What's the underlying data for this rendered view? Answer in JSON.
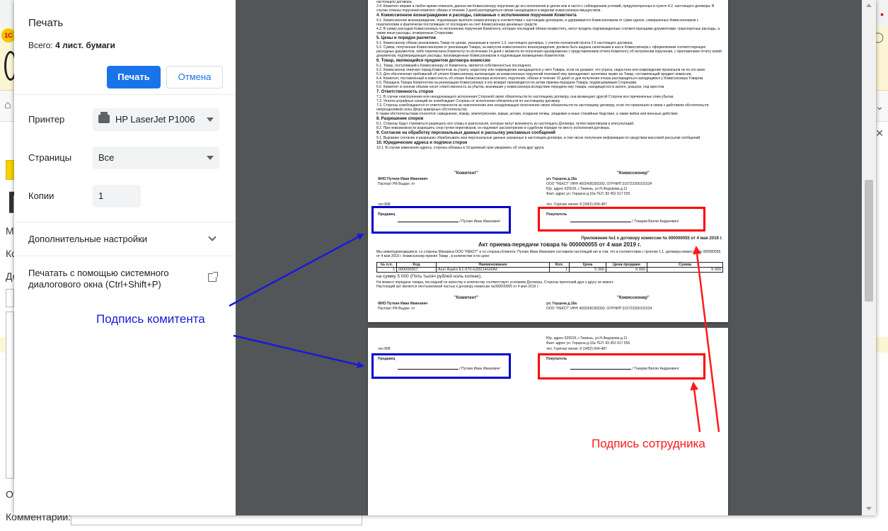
{
  "background": {
    "logo_text": "1С",
    "big_letter": "П",
    "labels": [
      "Ма",
      "Ко",
      "До"
    ],
    "bottom_label": "От",
    "comment_label": "Комментарий:"
  },
  "dialog": {
    "title": "Печать",
    "total_label": "Всего:",
    "total_value": "4 лист. бумаги",
    "print_button": "Печать",
    "cancel_button": "Отмена",
    "printer_label": "Принтер",
    "printer_value": "HP LaserJet P1006",
    "pages_label": "Страницы",
    "pages_value": "Все",
    "copies_label": "Копии",
    "copies_value": "1",
    "more_settings": "Дополнительные настройки",
    "system_dialog": "Печатать с помощью системного диалогового окна (Ctrl+Shift+P)"
  },
  "document": {
    "p1_top_lines": [
      "настоящего договора.",
      "3.4. Комитент вправе в любое время отменить данное им Комиссионеру поручение до его исполнения в целом или в части с соблюдением условий, предусмотренных в пункте 4.2. настоящего договора. В случае отмены поручения комитент обязан в течение 3 дней распорядиться своим находящимся в ведении комиссионера имуществом."
    ],
    "s4_title": "4. Комиссионное вознаграждение и расходы, связанные с исполнением поручения Комитента",
    "s4_lines": [
      "4.1. Комиссионное вознаграждение, подлежащее выплате комиссионеру в соответствии с настоящим договором, и удерживается Комиссионером от сумм сделок, совершенных Комиссионером с покупателями и фактически поступивших от последних на счет Комиссионера денежных средств.",
      "4.2. В сумму расходов Комиссионера по исполнению поручения Комитента, которые последний обязан возместить, могут входить подтвержденные соответствующими документами: транспортные расходы, а также иные расходы, оговоренные Сторонами."
    ],
    "s5_title": "5. Цены и порядок расчетов",
    "s5_lines": [
      "5.1. Комиссионер обязан реализовать Товар по ценам, указанным в пункте 1.2. настоящего договора, с учетом положений пункта 2.6 настоящего договора.",
      "5.2. Сумма, полученная Комиссионером от реализации Товара, за минусом комиссионного вознаграждения, должна быть выдана наличными в кассе Комиссионера с оформлением соответствующих расходных документов, либо перечислена Комитенту по истечении 14 дней с момента ее получения одновременно с представлением отчета Комитенту об исполнении поручения, с приложением отчету копий документов, подтверждающих расходы, произведенные Комиссионером и подлежащие возмещению Комитентом."
    ],
    "s6_title": "6. Товар, являющийся предметом договора комиссии",
    "s6_lines": [
      "6.1. Товар, поступивший к Комиссионеру от Комитента, является собственностью последнего.",
      "6.2. Комиссионер отвечает перед Комитентом за утрату, недостачу или повреждение находящегося у него Товара, если не докажет, что утрата, недостача или повреждение произошли не по его вине.",
      "6.3. Для обеспечения требований об уплате Комиссионеру вытекающих из комиссионных поручений платежей ему принадлежит залоговое право на Товар, составляющий предмет комиссии.",
      "6.4. Комитент, поставленный в известность об отказе Комиссионера исполнить поручение, обязан в течение 10 дней со дня получения отказа распорядиться находящимся у Комиссионера Товаром.",
      "6.5. Передача Товара Комитентом на реализацию Комиссионеру и его возврат производится по актам приема-передачи Товара, подписываемым Сторонами.",
      "6.6. Комитент в полном объеме несет ответственность за убытки, возникшие у комиссионера вследствие передачи ему товара, находящегося в залоге, розыске, под арестом."
    ],
    "s7_title": "7. Ответственность сторон",
    "s7_lines": [
      "7.1. В случае неисполнения или ненадлежащего исполнения Стороной своих обязательств по настоящему договору, она возмещает другой Стороне все причиненные этим убытки.",
      "7.2. Уплата штрафных санкций не освобождает Стороны от исполнения обязательств по настоящему договору.",
      "7.3. Стороны освобождаются от ответственности за неисполнение или ненадлежащее исполнение своих обязательств по настоящему договору, если это произошло в связи с действием обстоятельств непреодолимой силы (форс-мажорных обстоятельств).",
      "К таким обстоятельствам относятся: наводнение, пожар, землетрясение, взрыв, шторм, оседание почвы, эпидемия и иные стихийные бедствия, а также война или военные действия."
    ],
    "s8_title": "8. Разрешение споров",
    "s8_lines": [
      "8.1. Стороны будут стремиться разрешать все споры и разногласия, которые могут возникнуть из настоящего Договора, путем переговоров и консультаций.",
      "8.2. При невозможности разрешить спор путем переговоров, он подлежит рассмотрению в судебном порядке по месту исполнения договора."
    ],
    "s9_title": "9. Согласие на обработку персональных данных и рассылку рекламных сообщений",
    "s9_lines": [
      "9.1. Выражаю согласие и разрешаю обрабатывать мои персональные данные указанные в настоящем договоре, в том числе получение информации по средствам массовой рассылки сообщений."
    ],
    "s10_title": "10. Юридические адреса и подписи сторон",
    "s10_lines": [
      "10.1. В случае изменения адреса, стороны обязаны в 10-дневный срок уведомить об этом друг друга."
    ],
    "komitent_label": "\"Комитент\"",
    "komissioner_label": "\"Комиссионер\"",
    "fio_line": "ФИО Путкин Иван Иванович",
    "passport_line": "Паспорт РФ    Выдан:   от",
    "address_line": "ул. Герцена д.16а",
    "company_line": "ООО \"НЕКСТ\"    ИНН  4502436393393,        ОГРНИП 316723300101534",
    "legal_addr": "Юр. адрес 625016, г.Тюмень, ул.Н.Федорова д.11",
    "fact_addr": "Факт. адрес ул. Герцена д.16а ТЕЛ. 83 452 617 555",
    "phone_line": "тел. Горячая линия: 8 (3452) 604-487",
    "tel": "тел 898",
    "seller": "Продавец",
    "buyer": "Покупатель",
    "seller_sig": "/ Путкин Иван Иванович/",
    "buyer_sig": "/ Токарев Вилли Андреевич/",
    "appendix": "Приложение №1 к договору комиссии № 000000055 от 4 мая 2019 г.",
    "act_title": "Акт приема-передачи товара № 000000055 от 4 мая 2019 г.",
    "act_intro": "Мы нижеподписавшиеся, со стороны Магазина ООО \"НЕКСТ\" и со стороны Клиента: Путкин Иван Иванович  составили настоящий акт в том, что в соответствии с пунктом 1.1. договора комиссии № 000000055 от 4 мая 2019 г. Комиссионер принял Товар , в количестве и по цене:",
    "table_headers": [
      "№ п.п.",
      "Код",
      "Наименование",
      "Кол.",
      "Цена",
      "Цена продажи",
      "Сумма"
    ],
    "table_row": [
      "1",
      "000000007",
      "Acer Aspire E1-570-G33214G50M",
      "1",
      "5 000",
      "6 000",
      "5 000"
    ],
    "sum_line": "на сумму 5 000 (Пять тысяч рублей ноль копеек).",
    "act_lines": [
      "На момент передачи товара, последний по качеству и количеству соответствует условиям Договора, Стороны претензий друг к другу не имеют.",
      "Настоящий акт является неотъемлемой частью к договору комиссии №000000055 от 4 мая 2019 г."
    ],
    "company_short": "ООО \"НЕКСТ\"    ИНН  4502436393393,        ОГРНИП 316723300101534"
  },
  "annotations": {
    "komitent_caption": "Подпись комитента",
    "employee_caption": "Подпись сотрудника",
    "blue_color": "#0000cc",
    "red_color": "#ff0000"
  }
}
